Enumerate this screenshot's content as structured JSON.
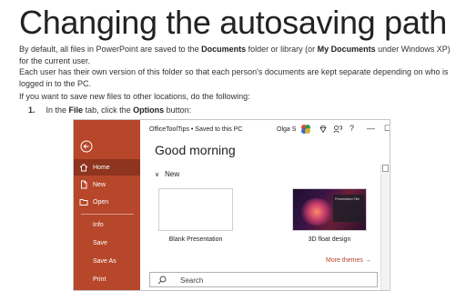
{
  "page": {
    "title": "Changing the autosaving path",
    "p1_a": "By default, all files in PowerPoint are saved to the ",
    "p1_b": "Documents",
    "p1_c": " folder or library (or ",
    "p1_d": "My Documents",
    "p1_e": " under Windows XP) for the current user.",
    "p2": "Each user has their own version of this folder so that each person's documents are kept separate depending on who is logged in to the PC.",
    "p3": "If you want to save new files to other locations, do the following:",
    "step_num": "1.",
    "step_a": "In the ",
    "step_b": "File",
    "step_c": " tab, click the ",
    "step_d": "Options",
    "step_e": " button:"
  },
  "office": {
    "titlebar": {
      "title": "OfficeToolTips • Saved to this PC",
      "user": "Olga S",
      "minimize": "—",
      "restore": "☐",
      "close": "✕"
    },
    "sidebar": {
      "items": [
        {
          "label": "Home",
          "icon": "home-icon"
        },
        {
          "label": "New",
          "icon": "new-file-icon"
        },
        {
          "label": "Open",
          "icon": "folder-icon"
        },
        {
          "label": "Info"
        },
        {
          "label": "Save"
        },
        {
          "label": "Save As"
        },
        {
          "label": "Print"
        }
      ]
    },
    "greeting": "Good morning",
    "new_section": "New",
    "templates": [
      {
        "label": "Blank Presentation"
      },
      {
        "label": "3D float design",
        "thumb_text": "Presentation Title"
      }
    ],
    "more_themes": "More themes →",
    "search_placeholder": "Search"
  },
  "colors": {
    "accent": "#b7472a",
    "sidebar_active": "#8e341f"
  }
}
